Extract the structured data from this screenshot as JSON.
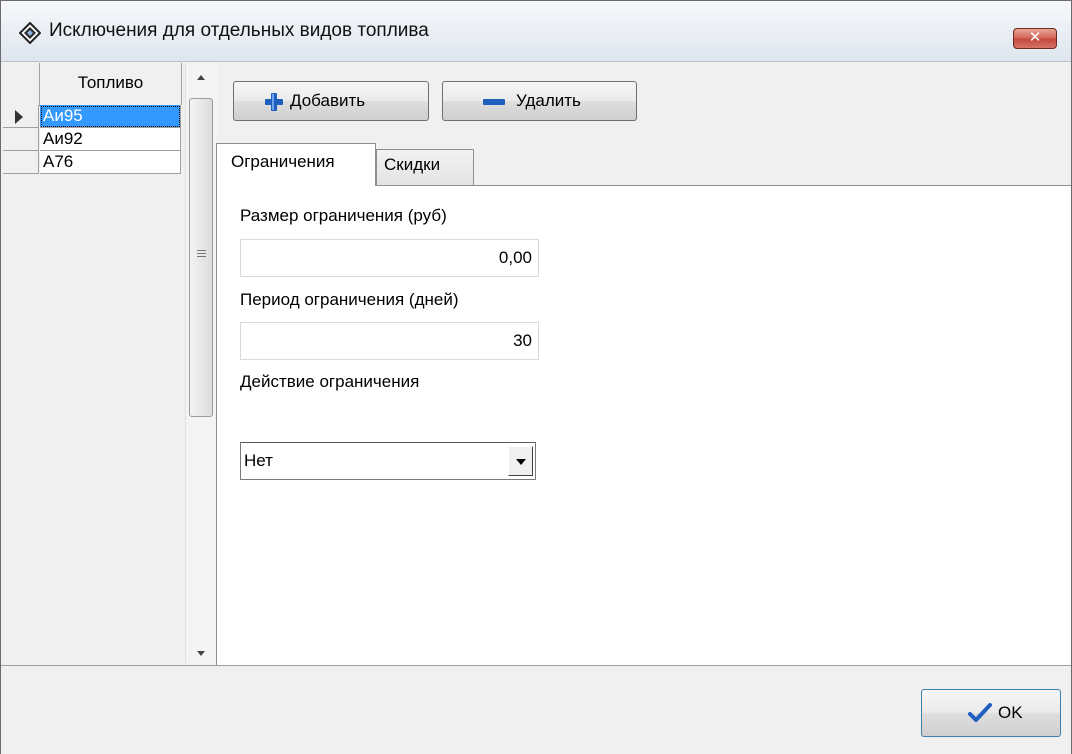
{
  "window": {
    "title": "Исключения для отдельных видов топлива"
  },
  "grid": {
    "column_header": "Топливо",
    "rows": [
      "Аи95",
      "Аи92",
      "А76"
    ],
    "selected_index": 0
  },
  "toolbar": {
    "add_label": "Добавить",
    "delete_label": "Удалить"
  },
  "tabs": [
    {
      "label": "Ограничения",
      "active": true
    },
    {
      "label": "Скидки",
      "active": false
    }
  ],
  "form": {
    "limit_size_label": "Размер ограничения (руб)",
    "limit_size_value": "0,00",
    "limit_period_label": "Период ограничения (дней)",
    "limit_period_value": "30",
    "limit_action_label": "Действие ограничения",
    "limit_action_value": "Нет"
  },
  "footer": {
    "ok_label": "OK"
  },
  "colors": {
    "selection": "#3399ff",
    "accent_blue": "#1f5fc0",
    "close_red": "#c2483c"
  }
}
